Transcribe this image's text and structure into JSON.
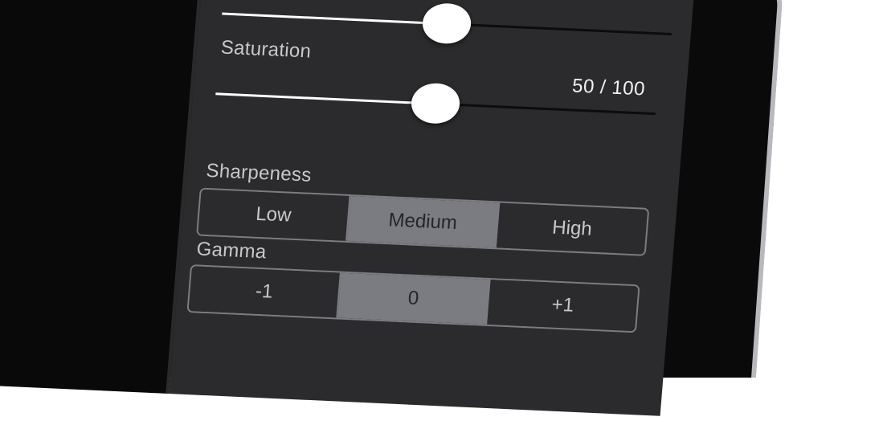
{
  "settings": {
    "saturation": {
      "label": "Saturation",
      "value_text": "50 / 100",
      "value": 50,
      "max": 100
    },
    "previous_slider_fraction": 0.5,
    "sharpness": {
      "label": "Sharpeness",
      "options": [
        "Low",
        "Medium",
        "High"
      ],
      "selected": "Medium"
    },
    "gamma": {
      "label": "Gamma",
      "options": [
        "-1",
        "0",
        "+1"
      ],
      "selected": "0"
    }
  },
  "colors": {
    "panel": "#2b2b2d",
    "selected_segment": "#7b7b82",
    "slider_fill": "#ffffff"
  }
}
